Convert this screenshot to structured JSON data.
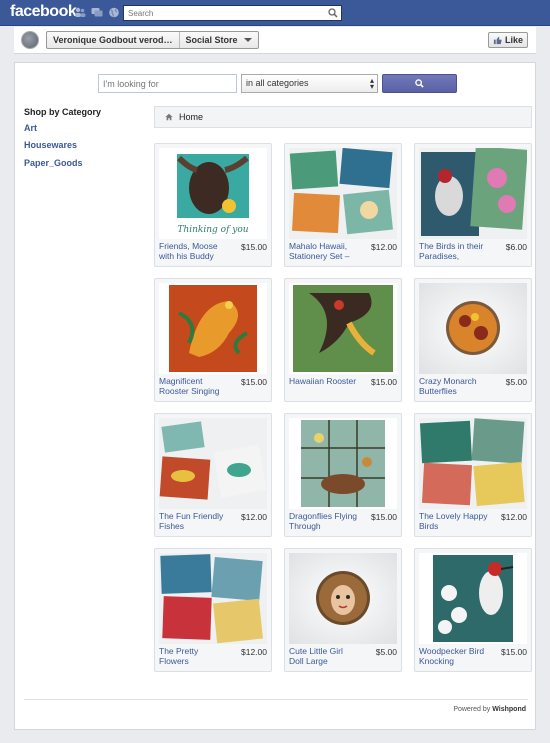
{
  "facebook": {
    "logo": "facebook",
    "search_placeholder": "Search"
  },
  "page": {
    "name": "Veronique Godbout verod…",
    "tab": "Social Store",
    "like_label": "Like"
  },
  "store": {
    "search_placeholder": "I'm looking for",
    "category_select": "in all categories",
    "sidebar_heading": "Shop by Category",
    "categories": [
      "Art",
      "Housewares",
      "Paper_Goods"
    ],
    "breadcrumb": "Home",
    "products": [
      {
        "title": "Friends, Moose with his Buddy",
        "price": "$15.00",
        "art": "moose"
      },
      {
        "title": "Mahalo Hawaii, Stationery Set –",
        "price": "$12.00",
        "art": "cards"
      },
      {
        "title": "The Birds in their Paradises,",
        "price": "$6.00",
        "art": "birds"
      },
      {
        "title": "Magnificent Rooster Singing",
        "price": "$15.00",
        "art": "rooster-red"
      },
      {
        "title": "Hawaiian Rooster",
        "price": "$15.00",
        "art": "rooster"
      },
      {
        "title": "Crazy Monarch Butterflies",
        "price": "$5.00",
        "art": "button-orange"
      },
      {
        "title": "The Fun Friendly Fishes",
        "price": "$12.00",
        "art": "fish-cards"
      },
      {
        "title": "Dragonflies Flying Through",
        "price": "$15.00",
        "art": "stained"
      },
      {
        "title": "The Lovely Happy Birds",
        "price": "$12.00",
        "art": "bird-cards"
      },
      {
        "title": "The Pretty Flowers",
        "price": "$12.00",
        "art": "flower-cards"
      },
      {
        "title": "Cute Little Girl Doll Large",
        "price": "$5.00",
        "art": "button-girl"
      },
      {
        "title": "Woodpecker Bird Knocking",
        "price": "$15.00",
        "art": "woodpecker"
      }
    ],
    "footer_prefix": "Powered by",
    "footer_brand": "Wishpond"
  },
  "colors": {
    "facebook_blue": "#3b5998",
    "link": "#3b5998",
    "search_button": "#6a70b4"
  }
}
